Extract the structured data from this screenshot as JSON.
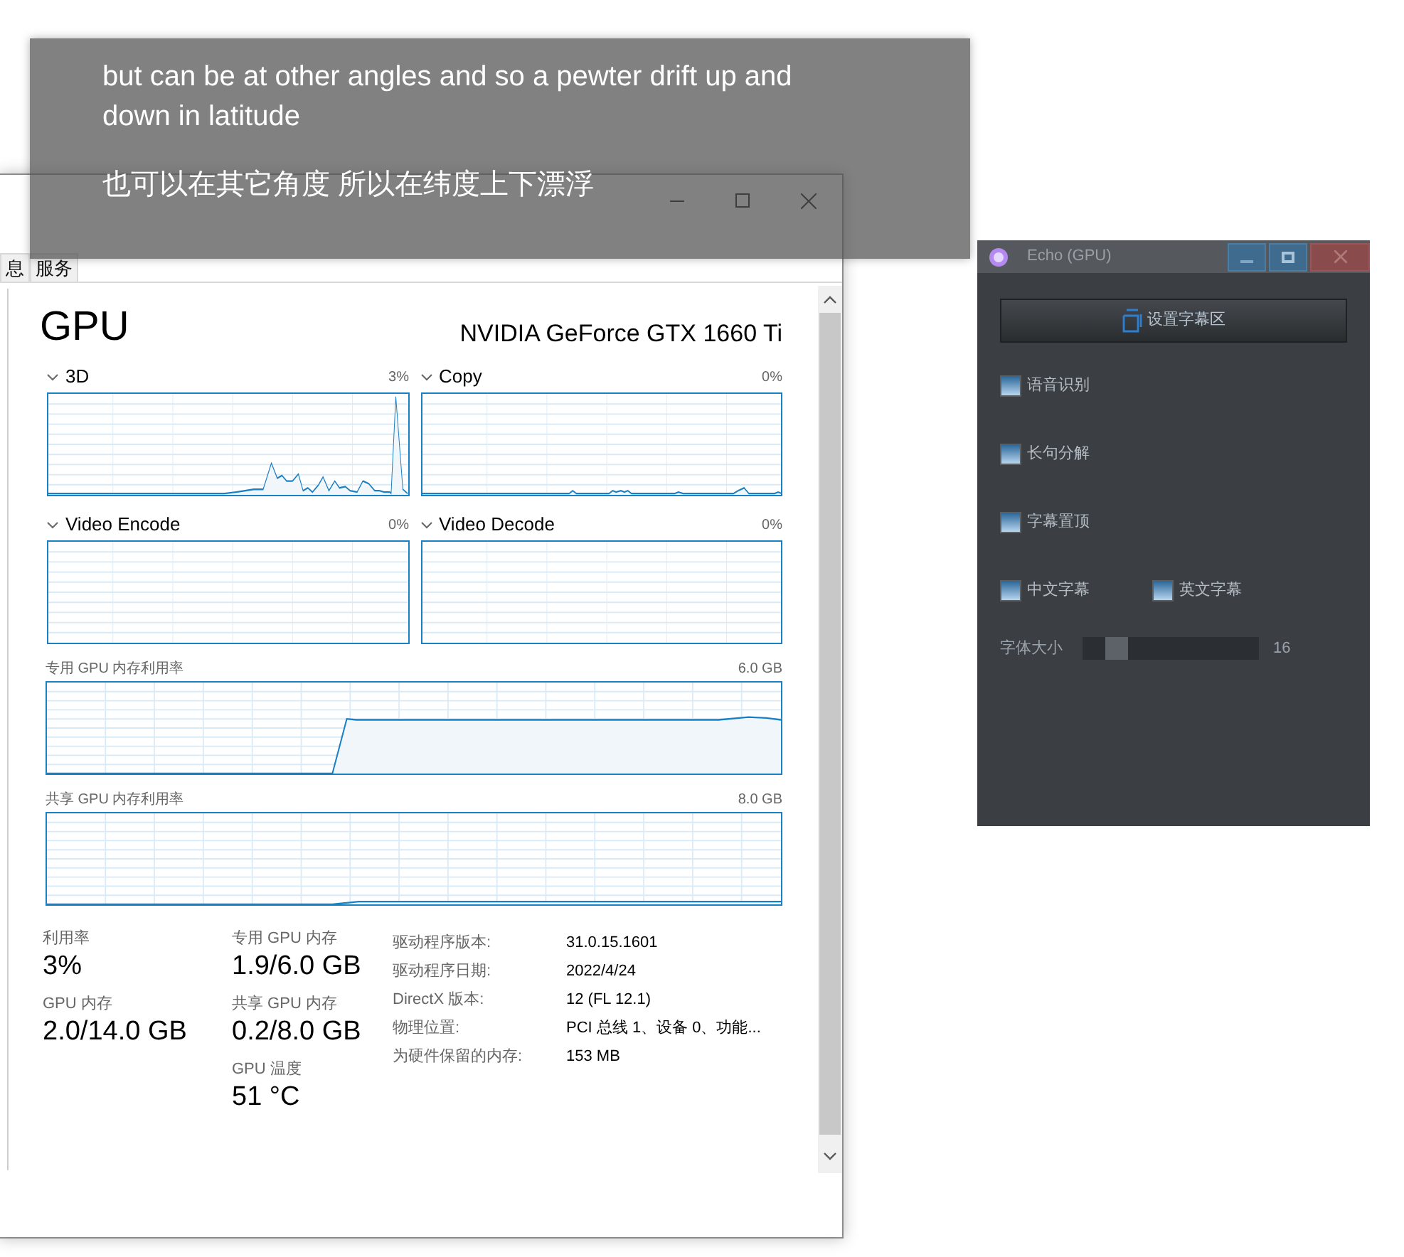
{
  "overlay": {
    "lines": [
      "but can be at other angles and so a pewter drift up and down in latitude",
      "也可以在其它角度 所以在纬度上下漂浮"
    ]
  },
  "task_manager": {
    "tabs": [
      "息",
      "服务"
    ],
    "title": "GPU",
    "device": "NVIDIA GeForce GTX 1660 Ti",
    "engines": [
      {
        "name": "3D",
        "value": "3%"
      },
      {
        "name": "Copy",
        "value": "0%"
      },
      {
        "name": "Video Encode",
        "value": "0%"
      },
      {
        "name": "Video Decode",
        "value": "0%"
      }
    ],
    "memory_graphs": [
      {
        "label": "专用 GPU 内存利用率",
        "max": "6.0 GB"
      },
      {
        "label": "共享 GPU 内存利用率",
        "max": "8.0 GB"
      }
    ],
    "stat_columns": [
      [
        {
          "label": "利用率",
          "value": "3%"
        },
        {
          "label": "GPU 内存",
          "value": "2.0/14.0 GB"
        }
      ],
      [
        {
          "label": "专用 GPU 内存",
          "value": "1.9/6.0 GB"
        },
        {
          "label": "共享 GPU 内存",
          "value": "0.2/8.0 GB"
        },
        {
          "label": "GPU 温度",
          "value": "51 °C"
        }
      ]
    ],
    "details": [
      {
        "label": "驱动程序版本:",
        "value": "31.0.15.1601"
      },
      {
        "label": "驱动程序日期:",
        "value": "2022/4/24"
      },
      {
        "label": "DirectX 版本:",
        "value": "12 (FL 12.1)"
      },
      {
        "label": "物理位置:",
        "value": "PCI 总线 1、设备 0、功能..."
      },
      {
        "label": "为硬件保留的内存:",
        "value": "153 MB"
      }
    ]
  },
  "echo": {
    "title": "Echo (GPU)",
    "button": "设置字幕区",
    "option_rows": [
      [
        {
          "label": "语音识别",
          "checked": true
        }
      ],
      [
        {
          "label": "长句分解",
          "checked": true
        }
      ],
      [
        {
          "label": "字幕置顶",
          "checked": true
        }
      ],
      [
        {
          "label": "中文字幕",
          "checked": true
        },
        {
          "label": "英文字幕",
          "checked": true
        }
      ]
    ],
    "font_size": {
      "label": "字体大小",
      "level": 0.15,
      "reading": "16"
    }
  }
}
